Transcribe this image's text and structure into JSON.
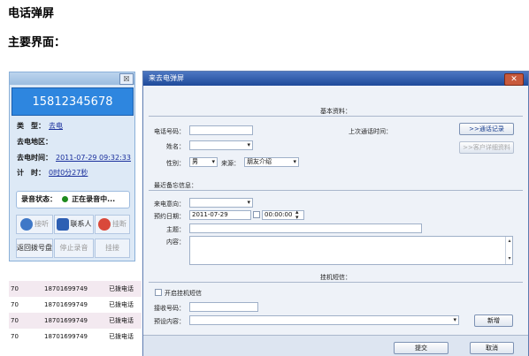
{
  "doc": {
    "heading1": "电话弹屏",
    "heading2": "主要界面："
  },
  "call_panel": {
    "close_label": "☒",
    "phone_number": "15812345678",
    "type_label": "类　型：",
    "type_value": "去电",
    "area_label": "去电地区：",
    "time_label": "去电时间：",
    "time_value": "2011-07-29 09:32:33",
    "duration_label": "计　时：",
    "duration_value": "0时0分27秒",
    "recording_label": "录音状态：",
    "recording_value": "正在录音中...",
    "buttons": [
      "接听",
      "联系人",
      "挂断",
      "返回拨号盘",
      "停止录音",
      "挂接"
    ],
    "colors": {
      "phone_bg": "#2e86df",
      "panel_bg": "#dde9f6",
      "record_dot": "#1e8a1e"
    }
  },
  "call_list": [
    {
      "c1": "70",
      "number": "18701699749",
      "status": "已拨电话"
    },
    {
      "c1": "70",
      "number": "18701699749",
      "status": "已拨电话"
    },
    {
      "c1": "70",
      "number": "18701699749",
      "status": "已拨电话"
    },
    {
      "c1": "70",
      "number": "18701699749",
      "status": "已拨电话"
    }
  ],
  "dialog": {
    "title": "来去电弹屏",
    "close_label": "✕",
    "basic_section": "基本资料：",
    "phone_label": "电话号码：",
    "last_call_label": "上次通话时间：",
    "call_log_button": ">>通话记录",
    "customer_detail_button": ">>客户详细资料",
    "name_label": "姓名：",
    "gender_label": "性别：",
    "gender_value": "男",
    "source_label": "来源：",
    "source_value": "朋友介绍",
    "memo_section": "最近备忘信息：",
    "intent_label": "来电意向：",
    "appointment_label": "预约日期：",
    "appointment_date": "2011-07-29",
    "appointment_time": "00:00:00",
    "subject_label": "主题：",
    "content_label": "内容：",
    "sms_section": "挂机短信：",
    "enable_sms_label": "开启挂机短信",
    "receiver_label": "接收号码：",
    "preset_label": "预设内容：",
    "add_button": "新增",
    "submit_button": "提交",
    "cancel_button": "取消",
    "colors": {
      "title_bg": "#1e4a9a",
      "dialog_bg": "#eef2f8"
    }
  }
}
